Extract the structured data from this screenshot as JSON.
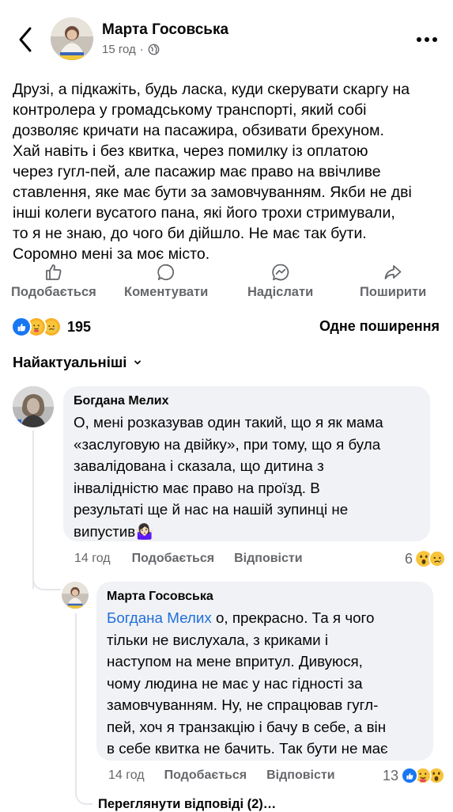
{
  "header": {
    "author_name": "Марта Госовська",
    "time": "15 год",
    "separator": "·",
    "audience_icon": "globe-icon",
    "back_icon": "chevron-left-icon",
    "more_icon": "more-horizontal-icon"
  },
  "post": {
    "text_lines": [
      "Друзі, а підкажіть, будь ласка, куди скерувати скаргу на",
      "контролера у громадському транспорті, який собі",
      "дозволяє кричати на пасажира, обзивати брехуном.",
      "Хай навіть і без квитка, через помилку із оплатою",
      "через гугл-пей, але пасажир має право на ввічливе",
      "ставлення, яке має бути за замовчуванням. Якби не дві",
      "інші колеги вусатого пана, які його трохи стримували,",
      "то я не знаю, до чого би дійшло. Не має так бути.",
      "Соромно мені за моє місто."
    ]
  },
  "actions": {
    "like": "Подобається",
    "comment": "Коментувати",
    "send": "Надіслати",
    "share": "Поширити"
  },
  "stats": {
    "reaction_count": "195",
    "shares": "Одне поширення"
  },
  "sort": {
    "label": "Найактуальніші"
  },
  "comments": [
    {
      "name": "Богдана Мелих",
      "lines": [
        "О, мені розказував один такий, що я як мама",
        "«заслуговую на двійку», при тому, що я була",
        "завалідована і сказала, що дитина з",
        "інвалідністю має право на проїзд. В",
        "результаті ще й нас на нашій зупинці не",
        "випустив🤷🏻‍♀️"
      ],
      "time": "14 год",
      "like": "Подобається",
      "reply": "Відповісти",
      "reaction_count": "6"
    },
    {
      "name": "Марта Госовська",
      "mention": "Богдана Мелих",
      "first_line_rest": " о, прекрасно. Та я чого",
      "lines": [
        "тільки не вислухала, з криками і",
        "наступом на мене впритул. Дивуюся,",
        "чому людина не має у нас гідності за",
        "замовчуванням. Ну, не спрацював гугл-",
        "пей, хоч я транзакцію і бачу в себе, а він",
        "в себе квитка не бачить. Так бути не має"
      ],
      "time": "14 год",
      "like": "Подобається",
      "reply": "Відповісти",
      "reaction_count": "13"
    }
  ],
  "view_replies": "Переглянути відповіді (2)…",
  "colors": {
    "accent": "#216fdb",
    "secondary_text": "#65676b",
    "bubble": "#f0f2f5"
  }
}
